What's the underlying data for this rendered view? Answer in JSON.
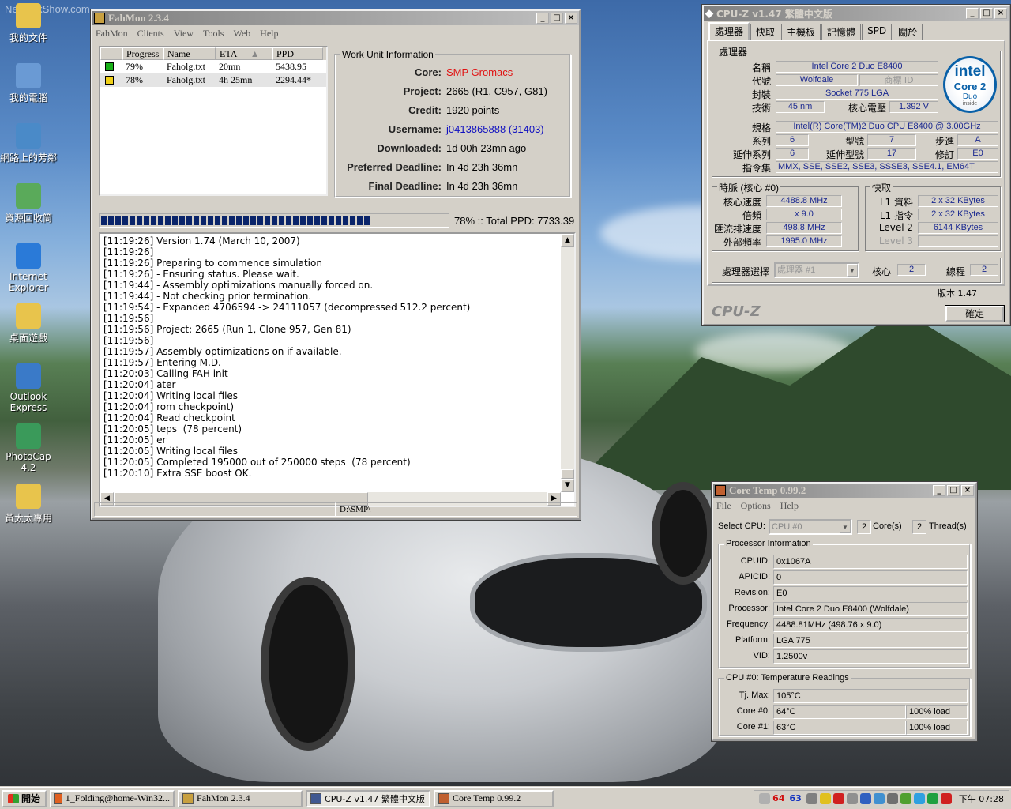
{
  "desktop": {
    "watermark": "NetworkShow.com",
    "icons": [
      {
        "label": "我的文件",
        "icon": "my-documents-icon",
        "color": "#e8c44c"
      },
      {
        "label": "我的電腦",
        "icon": "my-computer-icon",
        "color": "#6a9ad4"
      },
      {
        "label": "網路上的芳鄰",
        "icon": "network-places-icon",
        "color": "#4a8ac8"
      },
      {
        "label": "資源回收筒",
        "icon": "recycle-bin-icon",
        "color": "#5aaa5a"
      },
      {
        "label": "Internet Explorer",
        "icon": "internet-explorer-icon",
        "color": "#2a7ad8"
      },
      {
        "label": "桌面遊戲",
        "icon": "folder-icon",
        "color": "#e8c44c"
      },
      {
        "label": "Outlook Express",
        "icon": "outlook-express-icon",
        "color": "#3a7ac8"
      },
      {
        "label": "PhotoCap 4.2",
        "icon": "photocap-icon",
        "color": "#3a9a5a"
      },
      {
        "label": "黃太太專用",
        "icon": "folder-shortcut-icon",
        "color": "#e8c44c"
      }
    ]
  },
  "fahmon": {
    "title": "FahMon 2.3.4",
    "menu": [
      "FahMon",
      "Clients",
      "View",
      "Tools",
      "Web",
      "Help"
    ],
    "table": {
      "headers": [
        "Progress",
        "Name",
        "ETA",
        "PPD"
      ],
      "rows": [
        {
          "status_color": "#18b018",
          "progress": "79%",
          "name": "Faholg.txt",
          "eta": "20mn",
          "ppd": "5438.95"
        },
        {
          "status_color": "#f0d018",
          "progress": "78%",
          "name": "Faholg.txt",
          "eta": "4h 25mn",
          "ppd": "2294.44*"
        }
      ]
    },
    "wu": {
      "title": "Work Unit Information",
      "core_label": "Core:",
      "core": "SMP Gromacs",
      "project_label": "Project:",
      "project": "2665 (R1, C957, G81)",
      "credit_label": "Credit:",
      "credit": "1920 points",
      "username_label": "Username:",
      "username": "j0413865888",
      "team": "(31403)",
      "downloaded_label": "Downloaded:",
      "downloaded": "1d 00h 23mn ago",
      "pref_label": "Preferred Deadline:",
      "pref": "In 4d 23h 36mn",
      "final_label": "Final Deadline:",
      "final": "In 4d 23h 36mn"
    },
    "progress_fraction": 0.78,
    "progress_text": "78% :: Total PPD: 7733.39",
    "log": [
      "[11:19:26] Version 1.74 (March 10, 2007)",
      "[11:19:26]",
      "[11:19:26] Preparing to commence simulation",
      "[11:19:26] - Ensuring status. Please wait.",
      "[11:19:44] - Assembly optimizations manually forced on.",
      "[11:19:44] - Not checking prior termination.",
      "[11:19:54] - Expanded 4706594 -> 24111057 (decompressed 512.2 percent)",
      "[11:19:56]",
      "[11:19:56] Project: 2665 (Run 1, Clone 957, Gen 81)",
      "[11:19:56]",
      "[11:19:57] Assembly optimizations on if available.",
      "[11:19:57] Entering M.D.",
      "[11:20:03] Calling FAH init",
      "[11:20:04] ater",
      "[11:20:04] Writing local files",
      "[11:20:04] rom checkpoint)",
      "[11:20:04] Read checkpoint",
      "[11:20:05] teps  (78 percent)",
      "[11:20:05] er",
      "[11:20:05] Writing local files",
      "[11:20:05] Completed 195000 out of 250000 steps  (78 percent)",
      "[11:20:10] Extra SSE boost OK."
    ],
    "status_path": "D:\\SMP\\"
  },
  "cpuz": {
    "title": "CPU-Z v1.47 繁體中文版",
    "tabs": [
      "處理器",
      "快取",
      "主機板",
      "記憶體",
      "SPD",
      "關於"
    ],
    "proc_group": "處理器",
    "name_lbl": "名稱",
    "name": "Intel Core 2 Duo E8400",
    "code_lbl": "代號",
    "code": "Wolfdale",
    "brand_lbl": "商標 ID",
    "pkg_lbl": "封裝",
    "pkg": "Socket 775 LGA",
    "tech_lbl": "技術",
    "tech": "45 nm",
    "volt_lbl": "核心電壓",
    "volt": "1.392 V",
    "spec_lbl": "規格",
    "spec": "Intel(R) Core(TM)2 Duo CPU     E8400  @ 3.00GHz",
    "family_lbl": "系列",
    "family": "6",
    "model_lbl": "型號",
    "model": "7",
    "stepping_lbl": "步進",
    "stepping": "A",
    "extfam_lbl": "延伸系列",
    "extfam": "6",
    "extmodel_lbl": "延伸型號",
    "extmodel": "17",
    "rev_lbl": "修訂",
    "rev": "E0",
    "instr_lbl": "指令集",
    "instr": "MMX, SSE, SSE2, SSE3, SSSE3, SSE4.1, EM64T",
    "clock_group": "時脈 (核心 #0)",
    "cspeed_lbl": "核心速度",
    "cspeed": "4488.8 MHz",
    "mult_lbl": "倍頻",
    "mult": "x 9.0",
    "bus_lbl": "匯流排速度",
    "bus": "498.8 MHz",
    "fsb_lbl": "外部頻率",
    "fsb": "1995.0 MHz",
    "cache_group": "快取",
    "l1d_lbl": "L1 資料",
    "l1d": "2 x 32 KBytes",
    "l1i_lbl": "L1 指令",
    "l1i": "2 x 32 KBytes",
    "l2_lbl": "Level 2",
    "l2": "6144 KBytes",
    "l3_lbl": "Level 3",
    "sel_lbl": "處理器選擇",
    "sel": "處理器 #1",
    "cores_lbl": "核心",
    "cores": "2",
    "threads_lbl": "線程",
    "threads": "2",
    "version": "版本 1.47",
    "brand": "CPU-Z",
    "ok": "確定",
    "intel_logo": "intel",
    "core2_logo": "Core 2",
    "duo_logo": "Duo",
    "inside_logo": "inside"
  },
  "coretemp": {
    "title": "Core Temp 0.99.2",
    "menu": [
      "File",
      "Options",
      "Help"
    ],
    "select_lbl": "Select CPU:",
    "select": "CPU #0",
    "cores_n": "2",
    "cores_lbl": "Core(s)",
    "threads_n": "2",
    "threads_lbl": "Thread(s)",
    "info_group": "Processor Information",
    "cpuid_lbl": "CPUID:",
    "cpuid": "0x1067A",
    "apicid_lbl": "APICID:",
    "apicid": "0",
    "rev_lbl": "Revision:",
    "rev": "E0",
    "proc_lbl": "Processor:",
    "proc": "Intel Core 2 Duo E8400 (Wolfdale)",
    "freq_lbl": "Frequency:",
    "freq": "4488.81MHz (498.76 x 9.0)",
    "plat_lbl": "Platform:",
    "plat": "LGA 775",
    "vid_lbl": "VID:",
    "vid": "1.2500v",
    "temp_group": "CPU #0: Temperature Readings",
    "tj_lbl": "Tj. Max:",
    "tj": "105°C",
    "c0_lbl": "Core #0:",
    "c0": "64°C",
    "c0_load": "100% load",
    "c1_lbl": "Core #1:",
    "c1": "63°C",
    "c1_load": "100% load"
  },
  "taskbar": {
    "start": "開始",
    "buttons": [
      {
        "label": "1_Folding@home-Win32...",
        "icon": "firefox-icon",
        "color": "#e06020"
      },
      {
        "label": "FahMon 2.3.4",
        "icon": "fahmon-icon",
        "color": "#c8a040"
      },
      {
        "label": "CPU-Z v1.47 繁體中文版",
        "icon": "cpuz-icon",
        "color": "#405890"
      },
      {
        "label": "Core Temp 0.99.2",
        "icon": "coretemp-icon",
        "color": "#c06030"
      }
    ],
    "tray_temps": [
      "64",
      "63"
    ],
    "tray_temp_colors": [
      "#d01010",
      "#1030c0"
    ],
    "tray_icons": [
      {
        "icon": "keyboard-icon",
        "color": "#808080"
      },
      {
        "icon": "shield-icon",
        "color": "#e0c020"
      },
      {
        "icon": "antivirus-icon",
        "color": "#d02020"
      },
      {
        "icon": "gear-icon",
        "color": "#909090"
      },
      {
        "icon": "refresh-icon",
        "color": "#3060c0"
      },
      {
        "icon": "network-icon",
        "color": "#4090d0"
      },
      {
        "icon": "speaker-icon",
        "color": "#707070"
      },
      {
        "icon": "nvidia-icon",
        "color": "#50a030"
      },
      {
        "icon": "messenger-icon",
        "color": "#30a0e0"
      },
      {
        "icon": "chat-icon",
        "color": "#20a040"
      },
      {
        "icon": "flag-icon",
        "color": "#d02020"
      }
    ],
    "clock": "下午 07:28"
  }
}
